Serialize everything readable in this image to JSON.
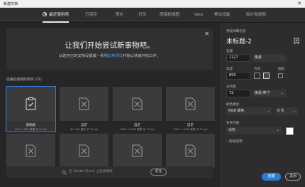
{
  "window": {
    "title": "新建文档",
    "close_glyph": "✕"
  },
  "tabs": [
    {
      "label": "最近使用项"
    },
    {
      "label": "已保存"
    },
    {
      "label": "照片"
    },
    {
      "label": "打印"
    },
    {
      "label": "图稿和插图"
    },
    {
      "label": "Web"
    },
    {
      "label": "移动设备"
    },
    {
      "label": "胶片和视频"
    }
  ],
  "banner": {
    "headline": "让我们开始尝试新事物吧。",
    "sub_before": "从您自己的文档设置或一系列",
    "sub_link": "文档预设",
    "sub_after": "开始以快速开始工作。",
    "close_glyph": "✕"
  },
  "recent": {
    "label": "您最近使用的项目 (21)",
    "items": [
      {
        "name": "剪贴板",
        "meta": "1127 x 895 像素 @ 72 ppi",
        "icon": "clipboard-icon",
        "selected": true
      },
      {
        "name": "自定",
        "meta": "60 x 80 厘米 @ 72 ppi",
        "icon": "custom-doc-icon"
      },
      {
        "name": "自定",
        "meta": "3000 x 3000 像素 @ 72 ppi",
        "icon": "custom-doc-icon"
      },
      {
        "name": "自定",
        "meta": "1920 x 1080 像素 @ 72 ppi",
        "icon": "custom-doc-icon"
      },
      {
        "name": "",
        "meta": "",
        "icon": "custom-doc-icon"
      },
      {
        "name": "",
        "meta": "",
        "icon": "custom-doc-icon"
      },
      {
        "name": "",
        "meta": "",
        "icon": "custom-doc-icon"
      },
      {
        "name": "",
        "meta": "",
        "icon": "custom-doc-icon"
      }
    ]
  },
  "stock": {
    "placeholder": "在 Adobe Stock 上查找模板",
    "go_label": "前往",
    "icon": "search-icon"
  },
  "preset": {
    "section_label": "预设详细信息",
    "doc_name": "未标题-2",
    "save_icon": "save-preset-icon",
    "width_label": "宽度",
    "width_value": "1127",
    "width_unit": "像素",
    "height_label": "高度",
    "height_value": "895",
    "orientation_label": "方向",
    "artboard_label": "画板",
    "resolution_label": "分辨率",
    "resolution_value": "72",
    "resolution_unit": "像素/英寸",
    "color_mode_label": "颜色模式",
    "color_mode_value": "RGB 颜色",
    "bit_depth_value": "8 位",
    "background_label": "背景内容",
    "background_value": "白色",
    "background_color": "#ffffff",
    "advanced_label": "高级选项",
    "create_label": "创建",
    "close_label": "关闭"
  }
}
